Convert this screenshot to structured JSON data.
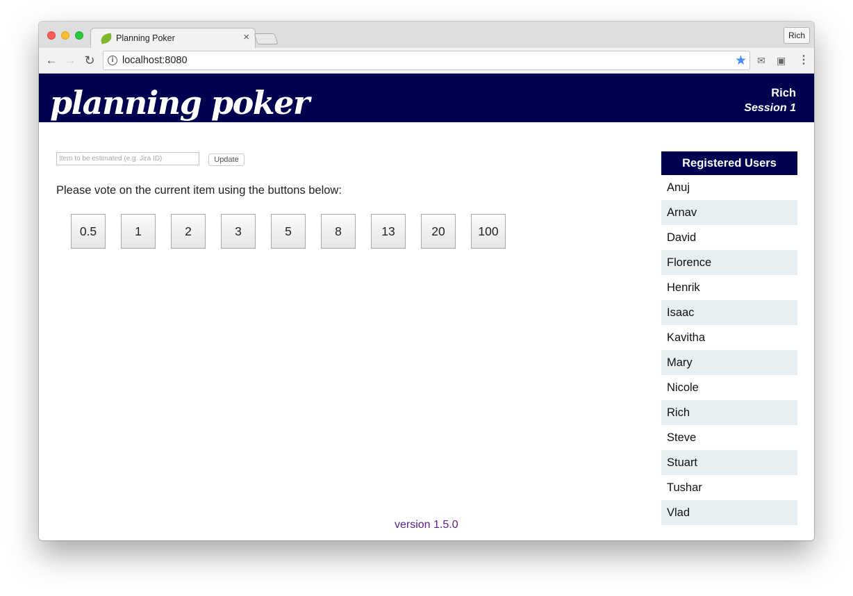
{
  "browser": {
    "tab_title": "Planning Poker",
    "tab_close": "×",
    "profile_label": "Rich",
    "url": "localhost:8080",
    "icons": {
      "back": "back-arrow-icon",
      "forward": "forward-arrow-icon",
      "reload": "reload-icon",
      "info": "info-icon",
      "star": "star-icon",
      "mail": "mail-extension-icon",
      "cast": "cast-icon",
      "menu": "more-menu-icon"
    }
  },
  "header": {
    "brand": "planning poker",
    "user": "Rich",
    "session": "Session 1",
    "background": "#000050"
  },
  "estimate": {
    "placeholder": "Item to be estimated (e.g. Jira ID)",
    "value": "",
    "update_label": "Update"
  },
  "instructions": "Please vote on the current item using the buttons below:",
  "vote_options": [
    "0.5",
    "1",
    "2",
    "3",
    "5",
    "8",
    "13",
    "20",
    "100"
  ],
  "users_panel": {
    "title": "Registered Users",
    "users": [
      "Anuj",
      "Arnav",
      "David",
      "Florence",
      "Henrik",
      "Isaac",
      "Kavitha",
      "Mary",
      "Nicole",
      "Rich",
      "Steve",
      "Stuart",
      "Tushar",
      "Vlad"
    ]
  },
  "footer": {
    "version": "version 1.5.0",
    "color": "#5a1c8c"
  }
}
